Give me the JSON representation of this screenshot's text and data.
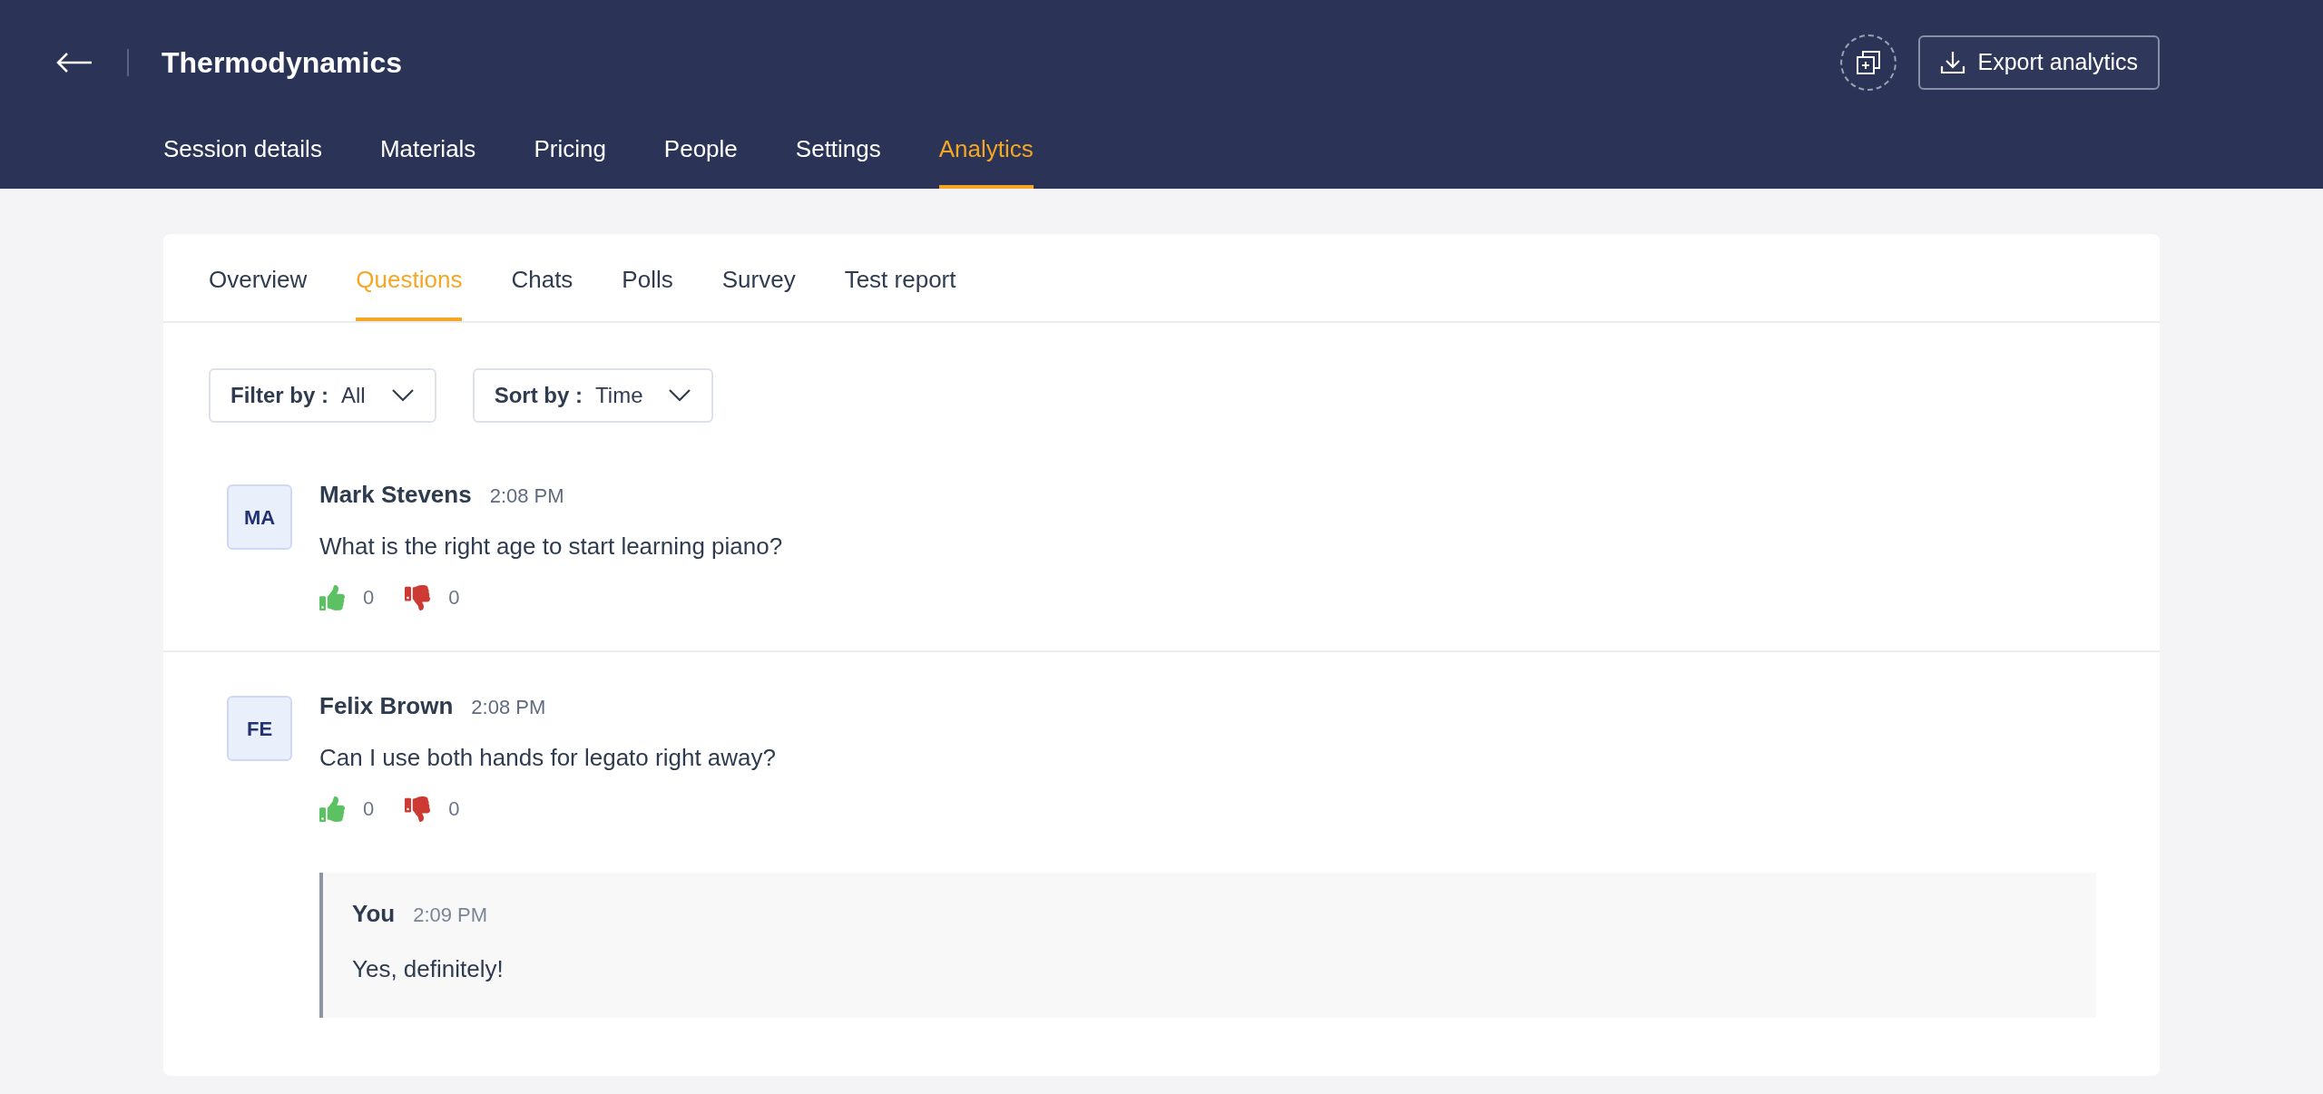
{
  "header": {
    "title": "Thermodynamics",
    "export_button": "Export analytics"
  },
  "nav_tabs": [
    {
      "label": "Session details",
      "selected": false
    },
    {
      "label": "Materials",
      "selected": false
    },
    {
      "label": "Pricing",
      "selected": false
    },
    {
      "label": "People",
      "selected": false
    },
    {
      "label": "Settings",
      "selected": false
    },
    {
      "label": "Analytics",
      "selected": true
    }
  ],
  "sub_tabs": [
    {
      "label": "Overview",
      "selected": false
    },
    {
      "label": "Questions",
      "selected": true
    },
    {
      "label": "Chats",
      "selected": false
    },
    {
      "label": "Polls",
      "selected": false
    },
    {
      "label": "Survey",
      "selected": false
    },
    {
      "label": "Test report",
      "selected": false
    }
  ],
  "filters": [
    {
      "label": "Filter by :",
      "value": "All"
    },
    {
      "label": "Sort by :",
      "value": "Time"
    }
  ],
  "questions": [
    {
      "initials": "MA",
      "name": "Mark Stevens",
      "time": "2:08 PM",
      "text": "What is the right age to start learning piano?",
      "upvotes": "0",
      "downvotes": "0"
    },
    {
      "initials": "FE",
      "name": "Felix Brown",
      "time": "2:08 PM",
      "text": "Can I use both hands for legato right away?",
      "upvotes": "0",
      "downvotes": "0",
      "replies": [
        {
          "name": "You",
          "time": "2:09 PM",
          "text": "Yes, definitely!"
        }
      ]
    }
  ]
}
